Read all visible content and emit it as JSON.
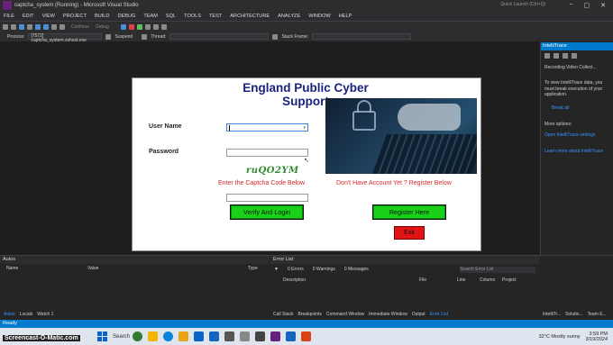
{
  "titlebar": {
    "title": "captcha_system (Running) - Microsoft Visual Studio",
    "quick_launch": "Quick Launch (Ctrl+Q)",
    "min": "−",
    "max": "▢",
    "close": "✕"
  },
  "menu": [
    "FILE",
    "EDIT",
    "VIEW",
    "PROJECT",
    "BUILD",
    "DEBUG",
    "TEAM",
    "SQL",
    "TOOLS",
    "TEST",
    "ARCHITECTURE",
    "ANALYZE",
    "WINDOW",
    "HELP"
  ],
  "toolbar": {
    "config": "Debug",
    "platform": "Continue"
  },
  "toolbar2": {
    "process_label": "Process:",
    "process_value": "[7572] captcha_system.vshost.exe",
    "suspend": "Suspend",
    "thread_label": "Thread:",
    "stack_label": "Stack Frame:"
  },
  "app": {
    "title": "England Public Cyber Support",
    "username_label": "User Name",
    "password_label": "Password",
    "captcha_code": "ruQO2YM",
    "captcha_prompt": "Enter the Captcha Code Below",
    "register_prompt": "Don't Have Account Yet ? Register Below",
    "verify_button": "Verify And Login",
    "register_button": "Register Here",
    "exit_button": "Exit"
  },
  "intellitrace": {
    "title": "IntelliTrace",
    "recording": "Recording Video Collect...",
    "info": "To view IntelliTrace data, you must break execution of your application.",
    "break_all": "Break all",
    "more_options": "More options:",
    "settings_link": "Open IntelliTrace settings",
    "learn_link": "Learn more about IntelliTrace"
  },
  "autos": {
    "title": "Autos",
    "columns": [
      "Name",
      "Value",
      "Type"
    ],
    "tabs": [
      "Autos",
      "Locals",
      "Watch 1"
    ]
  },
  "errors": {
    "title": "Error List",
    "errors": "0 Errors",
    "warnings": "0 Warnings",
    "messages": "0 Messages",
    "search": "Search Error List",
    "columns": [
      "Description",
      "File",
      "Line",
      "Column",
      "Project"
    ],
    "tabs": [
      "Call Stack",
      "Breakpoints",
      "Command Window",
      "Immediate Window",
      "Output",
      "Error List"
    ]
  },
  "right_tabs": [
    "IntelliTr...",
    "Solutio...",
    "Team E..."
  ],
  "status": {
    "text": "Ready"
  },
  "taskbar": {
    "search": "Search",
    "weather": "32°C Mostly sunny",
    "time": "3:59 PM",
    "date": "3/19/2024",
    "watermark": "Screencast-O-Matic.com"
  },
  "colors": {
    "accent": "#007acc",
    "title_blue": "#1a237e",
    "button_green": "#19d119",
    "button_red": "#e01414",
    "captcha_green": "#2e8b2e",
    "prompt_red": "#d62828"
  }
}
